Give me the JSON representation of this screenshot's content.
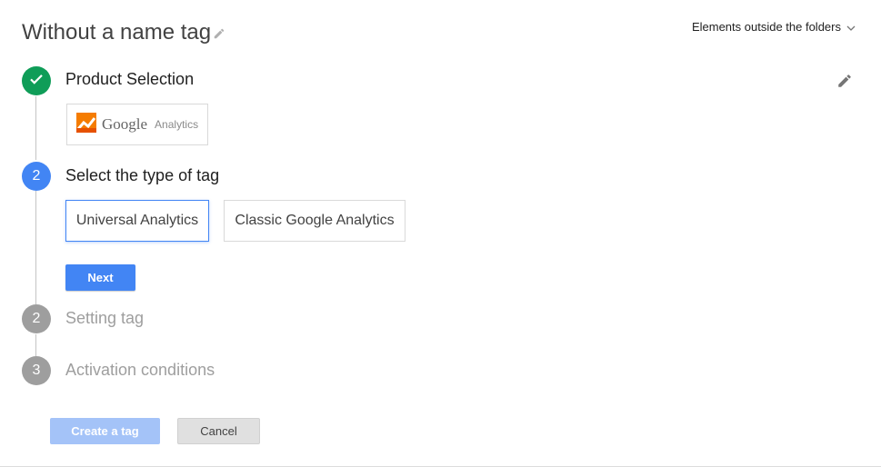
{
  "header": {
    "title": "Without a name tag",
    "folder_menu_label": "Elements outside the folders"
  },
  "steps": [
    {
      "number": "",
      "label": "Product Selection",
      "status": "complete"
    },
    {
      "number": "2",
      "label": "Select the type of tag",
      "status": "active"
    },
    {
      "number": "2",
      "label": "Setting tag",
      "status": "pending"
    },
    {
      "number": "3",
      "label": "Activation conditions",
      "status": "pending"
    }
  ],
  "product": {
    "brand": "Google",
    "product": "Analytics",
    "icon": "google-analytics-logo"
  },
  "tag_types": [
    {
      "label": "Universal Analytics",
      "selected": true
    },
    {
      "label": "Classic Google Analytics",
      "selected": false
    }
  ],
  "buttons": {
    "next": "Next",
    "create": "Create a tag",
    "cancel": "Cancel"
  },
  "colors": {
    "complete": "#0f9d58",
    "active": "#4285f4",
    "pending": "#9e9e9e",
    "create_disabled": "#a4c3f8"
  }
}
